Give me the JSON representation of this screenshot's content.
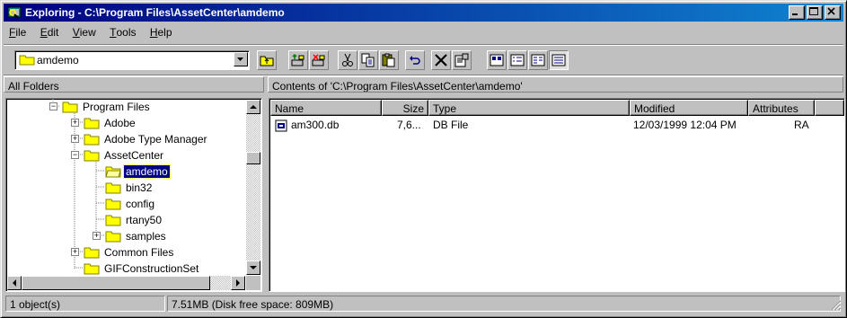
{
  "window": {
    "title": "Exploring - C:\\Program Files\\AssetCenter\\amdemo"
  },
  "menu": [
    {
      "label": "File",
      "u": "F",
      "rest": "ile"
    },
    {
      "label": "Edit",
      "u": "E",
      "rest": "dit"
    },
    {
      "label": "View",
      "u": "V",
      "rest": "iew"
    },
    {
      "label": "Tools",
      "u": "T",
      "rest": "ools"
    },
    {
      "label": "Help",
      "u": "H",
      "rest": "elp"
    }
  ],
  "toolbar": {
    "address_value": "amdemo"
  },
  "left_header": "All Folders",
  "right_header": "Contents of 'C:\\Program Files\\AssetCenter\\amdemo'",
  "tree": [
    {
      "label": "Program Files",
      "level": 0,
      "expander": "minus"
    },
    {
      "label": "Adobe",
      "level": 1,
      "expander": "plus"
    },
    {
      "label": "Adobe Type Manager",
      "level": 1,
      "expander": "plus"
    },
    {
      "label": "AssetCenter",
      "level": 1,
      "expander": "minus"
    },
    {
      "label": "amdemo",
      "level": 2,
      "expander": "none",
      "selected": true
    },
    {
      "label": "bin32",
      "level": 2,
      "expander": "none"
    },
    {
      "label": "config",
      "level": 2,
      "expander": "none"
    },
    {
      "label": "rtany50",
      "level": 2,
      "expander": "none"
    },
    {
      "label": "samples",
      "level": 2,
      "expander": "plus"
    },
    {
      "label": "Common Files",
      "level": 1,
      "expander": "plus"
    },
    {
      "label": "GIFConstructionSet",
      "level": 1,
      "expander": "none"
    }
  ],
  "columns": [
    "Name",
    "Size",
    "Type",
    "Modified",
    "Attributes"
  ],
  "files": [
    {
      "name": "am300.db",
      "size": "7,6...",
      "type": "DB File",
      "modified": "12/03/1999 12:04 PM",
      "attributes": "RA"
    }
  ],
  "status": {
    "objects": "1 object(s)",
    "size": "7.51MB (Disk free space: 809MB)"
  },
  "colors": {
    "title_start": "#000080",
    "title_end": "#1084d0",
    "face": "#c0c0c0",
    "selection": "#000080",
    "folder": "#ffff00"
  },
  "icons": [
    "explorer-icon",
    "minimize-icon",
    "maximize-icon",
    "close-icon",
    "folder-icon",
    "up-folder-icon",
    "map-drive-icon",
    "disconnect-drive-icon",
    "cut-icon",
    "copy-icon",
    "paste-icon",
    "undo-icon",
    "delete-icon",
    "properties-icon",
    "large-icons-icon",
    "small-icons-icon",
    "list-icon",
    "details-icon",
    "db-file-icon"
  ]
}
